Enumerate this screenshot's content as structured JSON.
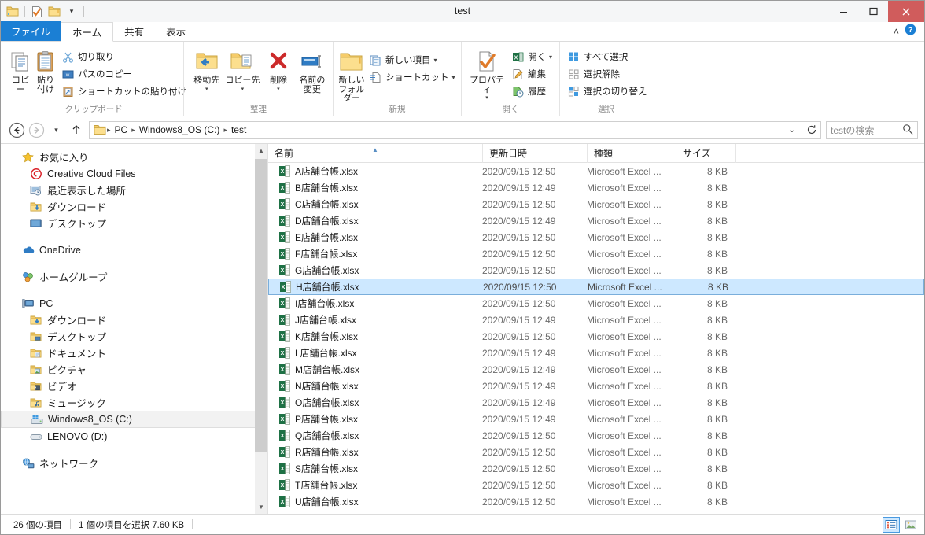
{
  "window": {
    "title": "test",
    "minimize": "–",
    "maximize": "□",
    "close": "✕"
  },
  "quick_access": {
    "folder_icon": "folder-icon",
    "properties_icon": "properties-icon",
    "new_folder_icon": "new-folder-icon",
    "dropdown": "▾"
  },
  "tabs": [
    {
      "label": "ファイル",
      "kind": "file"
    },
    {
      "label": "ホーム",
      "kind": "active"
    },
    {
      "label": "共有",
      "kind": "normal"
    },
    {
      "label": "表示",
      "kind": "normal"
    }
  ],
  "tab_right": {
    "collapse": "˄",
    "help": "?"
  },
  "ribbon": {
    "groups": [
      {
        "label": "クリップボード",
        "big": [
          {
            "label": "コピー",
            "icon": "copy-icon"
          },
          {
            "label": "貼り付け",
            "icon": "paste-icon"
          }
        ],
        "small": [
          {
            "label": "切り取り",
            "icon": "cut-icon"
          },
          {
            "label": "パスのコピー",
            "icon": "copy-path-icon"
          },
          {
            "label": "ショートカットの貼り付け",
            "icon": "paste-shortcut-icon"
          }
        ]
      },
      {
        "label": "整理",
        "big": [
          {
            "label": "移動先",
            "icon": "move-to-icon",
            "caret": "▾"
          },
          {
            "label": "コピー先",
            "icon": "copy-to-icon",
            "caret": "▾"
          },
          {
            "label": "削除",
            "icon": "delete-icon",
            "caret": "▾"
          },
          {
            "label": "名前の\n変更",
            "icon": "rename-icon"
          }
        ],
        "small": []
      },
      {
        "label": "新規",
        "big": [
          {
            "label": "新しい\nフォルダー",
            "icon": "new-folder-big-icon"
          }
        ],
        "small": [
          {
            "label": "新しい項目",
            "icon": "new-item-icon",
            "caret": "▾"
          },
          {
            "label": "ショートカット",
            "icon": "shortcut-icon",
            "caret": "▾"
          }
        ]
      },
      {
        "label": "開く",
        "big": [
          {
            "label": "プロパティ",
            "icon": "properties-big-icon",
            "caret": "▾"
          }
        ],
        "small": [
          {
            "label": "開く",
            "icon": "excel-open-icon",
            "caret": "▾"
          },
          {
            "label": "編集",
            "icon": "edit-icon"
          },
          {
            "label": "履歴",
            "icon": "history-icon"
          }
        ]
      },
      {
        "label": "選択",
        "big": [],
        "small": [
          {
            "label": "すべて選択",
            "icon": "select-all-icon"
          },
          {
            "label": "選択解除",
            "icon": "select-none-icon"
          },
          {
            "label": "選択の切り替え",
            "icon": "invert-selection-icon"
          }
        ]
      }
    ]
  },
  "address": {
    "back": "←",
    "forward": "→",
    "recent": "▾",
    "up": "↑",
    "folder_icon": "folder-icon",
    "breadcrumbs": [
      "PC",
      "Windows8_OS (C:)",
      "test"
    ],
    "separator": "▸",
    "dropdown": "⌄",
    "refresh": "↻"
  },
  "search": {
    "placeholder": "testの検索",
    "icon": "search-icon"
  },
  "sidebar": {
    "sections": [
      {
        "header": {
          "label": "お気に入り",
          "icon": "star-icon"
        },
        "items": [
          {
            "label": "Creative Cloud Files",
            "icon": "creative-cloud-icon"
          },
          {
            "label": "最近表示した場所",
            "icon": "recent-places-icon"
          },
          {
            "label": "ダウンロード",
            "icon": "downloads-icon"
          },
          {
            "label": "デスクトップ",
            "icon": "desktop-icon"
          }
        ]
      },
      {
        "header": {
          "label": "OneDrive",
          "icon": "onedrive-icon"
        },
        "items": []
      },
      {
        "header": {
          "label": "ホームグループ",
          "icon": "homegroup-icon"
        },
        "items": []
      },
      {
        "header": {
          "label": "PC",
          "icon": "pc-icon"
        },
        "items": [
          {
            "label": "ダウンロード",
            "icon": "downloads-icon"
          },
          {
            "label": "デスクトップ",
            "icon": "desktop-folder-icon"
          },
          {
            "label": "ドキュメント",
            "icon": "documents-icon"
          },
          {
            "label": "ピクチャ",
            "icon": "pictures-icon"
          },
          {
            "label": "ビデオ",
            "icon": "videos-icon"
          },
          {
            "label": "ミュージック",
            "icon": "music-icon"
          },
          {
            "label": "Windows8_OS (C:)",
            "icon": "drive-windows-icon",
            "selected": true
          },
          {
            "label": "LENOVO (D:)",
            "icon": "drive-icon"
          }
        ]
      },
      {
        "header": {
          "label": "ネットワーク",
          "icon": "network-icon"
        },
        "items": []
      }
    ]
  },
  "file_list": {
    "columns": [
      {
        "label": "名前",
        "key": "name",
        "sorted": true,
        "sort_dir": "asc"
      },
      {
        "label": "更新日時",
        "key": "date"
      },
      {
        "label": "種類",
        "key": "type"
      },
      {
        "label": "サイズ",
        "key": "size"
      }
    ],
    "rows": [
      {
        "name": "A店舗台帳.xlsx",
        "date": "2020/09/15 12:50",
        "type": "Microsoft Excel ...",
        "size": "8 KB"
      },
      {
        "name": "B店舗台帳.xlsx",
        "date": "2020/09/15 12:49",
        "type": "Microsoft Excel ...",
        "size": "8 KB"
      },
      {
        "name": "C店舗台帳.xlsx",
        "date": "2020/09/15 12:50",
        "type": "Microsoft Excel ...",
        "size": "8 KB"
      },
      {
        "name": "D店舗台帳.xlsx",
        "date": "2020/09/15 12:49",
        "type": "Microsoft Excel ...",
        "size": "8 KB"
      },
      {
        "name": "E店舗台帳.xlsx",
        "date": "2020/09/15 12:50",
        "type": "Microsoft Excel ...",
        "size": "8 KB"
      },
      {
        "name": "F店舗台帳.xlsx",
        "date": "2020/09/15 12:50",
        "type": "Microsoft Excel ...",
        "size": "8 KB"
      },
      {
        "name": "G店舗台帳.xlsx",
        "date": "2020/09/15 12:50",
        "type": "Microsoft Excel ...",
        "size": "8 KB"
      },
      {
        "name": "H店舗台帳.xlsx",
        "date": "2020/09/15 12:50",
        "type": "Microsoft Excel ...",
        "size": "8 KB",
        "selected": true
      },
      {
        "name": "I店舗台帳.xlsx",
        "date": "2020/09/15 12:50",
        "type": "Microsoft Excel ...",
        "size": "8 KB"
      },
      {
        "name": "J店舗台帳.xlsx",
        "date": "2020/09/15 12:49",
        "type": "Microsoft Excel ...",
        "size": "8 KB"
      },
      {
        "name": "K店舗台帳.xlsx",
        "date": "2020/09/15 12:50",
        "type": "Microsoft Excel ...",
        "size": "8 KB"
      },
      {
        "name": "L店舗台帳.xlsx",
        "date": "2020/09/15 12:49",
        "type": "Microsoft Excel ...",
        "size": "8 KB"
      },
      {
        "name": "M店舗台帳.xlsx",
        "date": "2020/09/15 12:49",
        "type": "Microsoft Excel ...",
        "size": "8 KB"
      },
      {
        "name": "N店舗台帳.xlsx",
        "date": "2020/09/15 12:49",
        "type": "Microsoft Excel ...",
        "size": "8 KB"
      },
      {
        "name": "O店舗台帳.xlsx",
        "date": "2020/09/15 12:49",
        "type": "Microsoft Excel ...",
        "size": "8 KB"
      },
      {
        "name": "P店舗台帳.xlsx",
        "date": "2020/09/15 12:49",
        "type": "Microsoft Excel ...",
        "size": "8 KB"
      },
      {
        "name": "Q店舗台帳.xlsx",
        "date": "2020/09/15 12:50",
        "type": "Microsoft Excel ...",
        "size": "8 KB"
      },
      {
        "name": "R店舗台帳.xlsx",
        "date": "2020/09/15 12:50",
        "type": "Microsoft Excel ...",
        "size": "8 KB"
      },
      {
        "name": "S店舗台帳.xlsx",
        "date": "2020/09/15 12:50",
        "type": "Microsoft Excel ...",
        "size": "8 KB"
      },
      {
        "name": "T店舗台帳.xlsx",
        "date": "2020/09/15 12:50",
        "type": "Microsoft Excel ...",
        "size": "8 KB"
      },
      {
        "name": "U店舗台帳.xlsx",
        "date": "2020/09/15 12:50",
        "type": "Microsoft Excel ...",
        "size": "8 KB"
      }
    ]
  },
  "status": {
    "item_count": "26 個の項目",
    "selection": "1 個の項目を選択  7.60 KB",
    "view_details": "details-view-icon",
    "view_large": "large-icons-view-icon"
  },
  "colors": {
    "accent": "#1b7fd4",
    "selection": "#cde8ff",
    "selection_border": "#7aaedb",
    "close_button": "#d05c5c",
    "excel_green": "#1e7145"
  }
}
